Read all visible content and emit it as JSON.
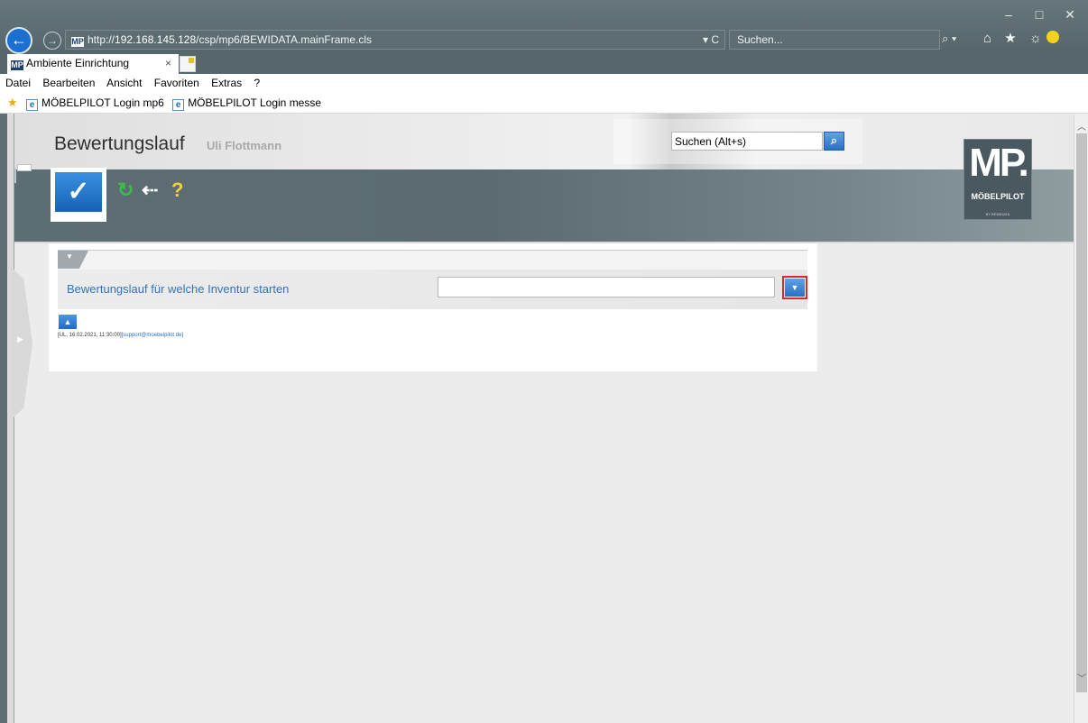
{
  "browser": {
    "url_prefix": "http://",
    "url_host": "192.168.145.128",
    "url_path": "/csp/mp6/BEWIDATA.mainFrame.cls",
    "url_tools": "▾ C",
    "search_placeholder": "Suchen...",
    "search_btn": "⌕ ▾",
    "tab_title": "Ambiente Einrichtung",
    "tab_close": "×",
    "window_min": "–",
    "window_max": "□",
    "window_close": "✕",
    "icons": "⌂ ★ ☼"
  },
  "menu": [
    "Datei",
    "Bearbeiten",
    "Ansicht",
    "Favoriten",
    "Extras",
    "?"
  ],
  "favorites": [
    "MÖBELPILOT Login mp6",
    "MÖBELPILOT Login messe"
  ],
  "header": {
    "title": "Bewertungslauf",
    "user": "Uli Flottmann",
    "search_value": "Suchen (Alt+s)"
  },
  "toolbar": {
    "confirm": "✓",
    "refresh": "↻",
    "back": "⇠",
    "help": "?"
  },
  "logo": {
    "mark": "MP.",
    "name": "MÖBELPILOT",
    "sub": "BY BEWIDATA"
  },
  "form": {
    "label": "Bewertungslauf für welche Inventur starten",
    "select_value": ""
  },
  "footer": {
    "info": "[UL, 16.02.2021, 11:30:00]",
    "mail": "[support@moebelpilot.de]"
  }
}
